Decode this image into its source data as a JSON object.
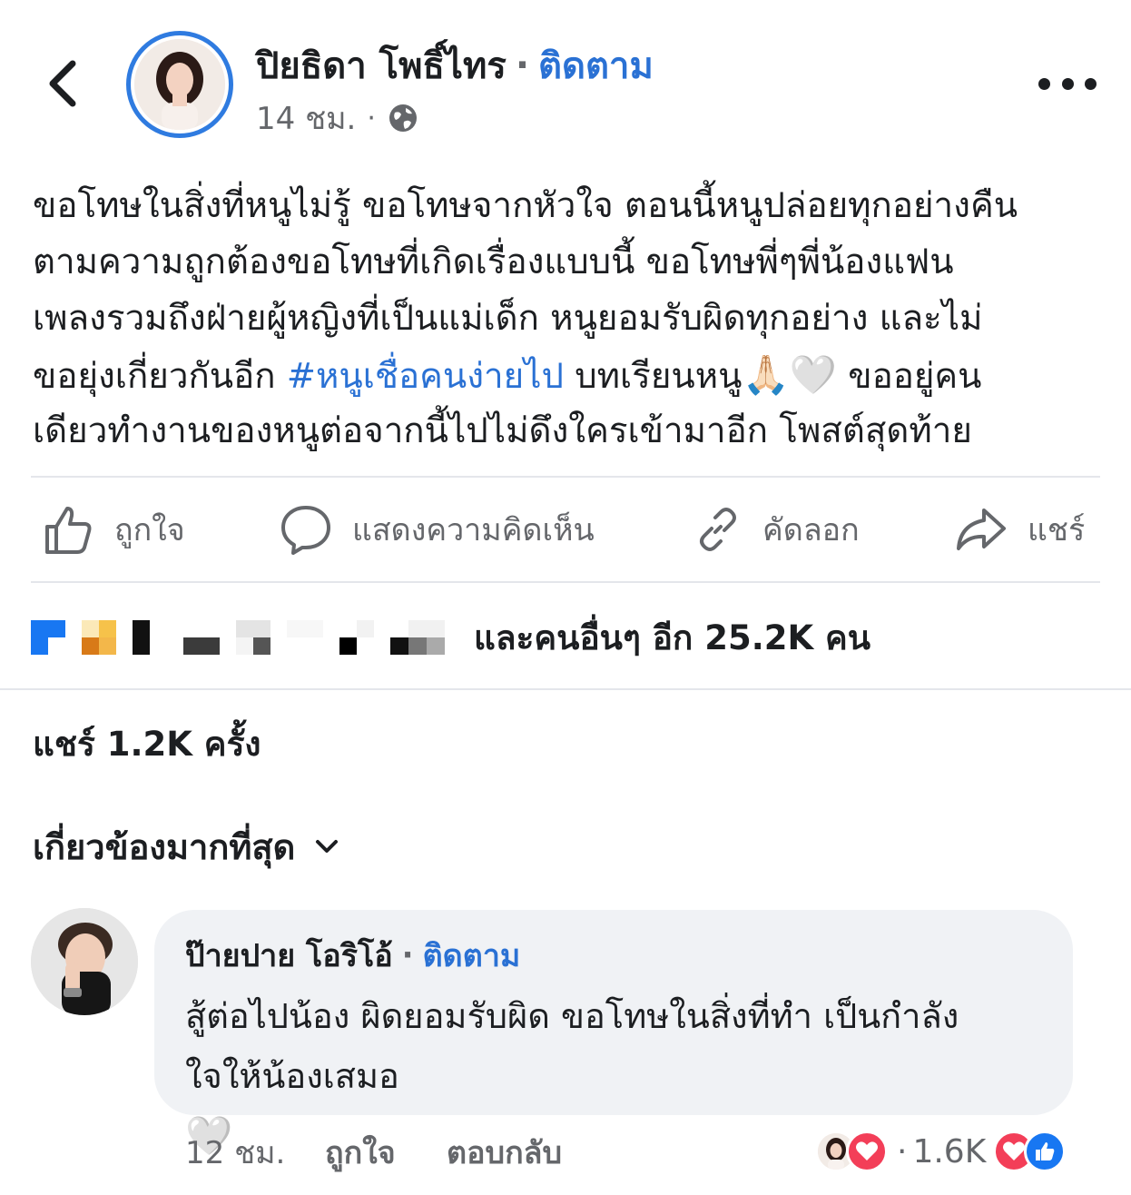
{
  "header": {
    "author_name": "ปิยธิดา โพธิ์ไทร",
    "separator": "·",
    "follow_label": "ติดตาม",
    "time": "14 ชม.",
    "meta_separator": "·",
    "privacy_icon": "globe-icon",
    "more_icon": "more-horizontal-icon",
    "back_icon": "chevron-left-icon"
  },
  "post": {
    "line1": "ขอโทษในสิ่งที่หนูไม่รู้ ขอโทษจากหัวใจ ตอนนี้หนูปล่อยทุกอย่างคืน",
    "line2": "ตามความถูกต้องขอโทษที่เกิดเรื่องแบบนี้ ขอโทษพี่ๆพี่น้องแฟน",
    "line3": "เพลงรวมถึงฝ่ายผู้หญิงที่เป็นแม่เด็ก หนูยอมรับผิดทุกอย่าง และไม่",
    "line4_before": "ขอยุ่งเกี่ยวกันอีก ",
    "hashtag": "#หนูเชื่อคนง่ายไป",
    "line4_after": " บทเรียนหนู",
    "emoji_pray": "🙏🏻",
    "emoji_heart": "🤍",
    "line4_end": " ขออยู่คน",
    "line5": "เดียวทำงานของหนูต่อจากนี้ไปไม่ดึงใครเข้ามาอีก โพสต์สุดท้าย"
  },
  "actions": {
    "like": "ถูกใจ",
    "comment": "แสดงความคิดเห็น",
    "copy": "คัดลอก",
    "share": "แชร์"
  },
  "reactions": {
    "summary": "และคนอื่นๆ อีก 25.2K คน"
  },
  "shares": {
    "label": "แชร์ 1.2K ครั้ง"
  },
  "sort": {
    "label": "เกี่ยวข้องมากที่สุด"
  },
  "comment": {
    "author": "ป๊ายปาย โอริโอ้",
    "separator": "·",
    "follow_label": "ติดตาม",
    "line1": "สู้ต่อไปน้อง ผิดยอมรับผิด ขอโทษในสิ่งที่ทำ เป็นกำลัง",
    "line2": "ใจให้น้องเสมอ ",
    "emoji_heart": "🤍",
    "time": "12 ชม.",
    "like": "ถูกใจ",
    "reply": "ตอบกลับ",
    "reaction_separator": "·",
    "reaction_count": "1.6K"
  },
  "colors": {
    "accent": "#2a71d4",
    "muted": "#65676b",
    "divider": "#e4e6eb",
    "bubble": "#f0f2f5",
    "love": "#f33e58",
    "like": "#1877f2"
  }
}
